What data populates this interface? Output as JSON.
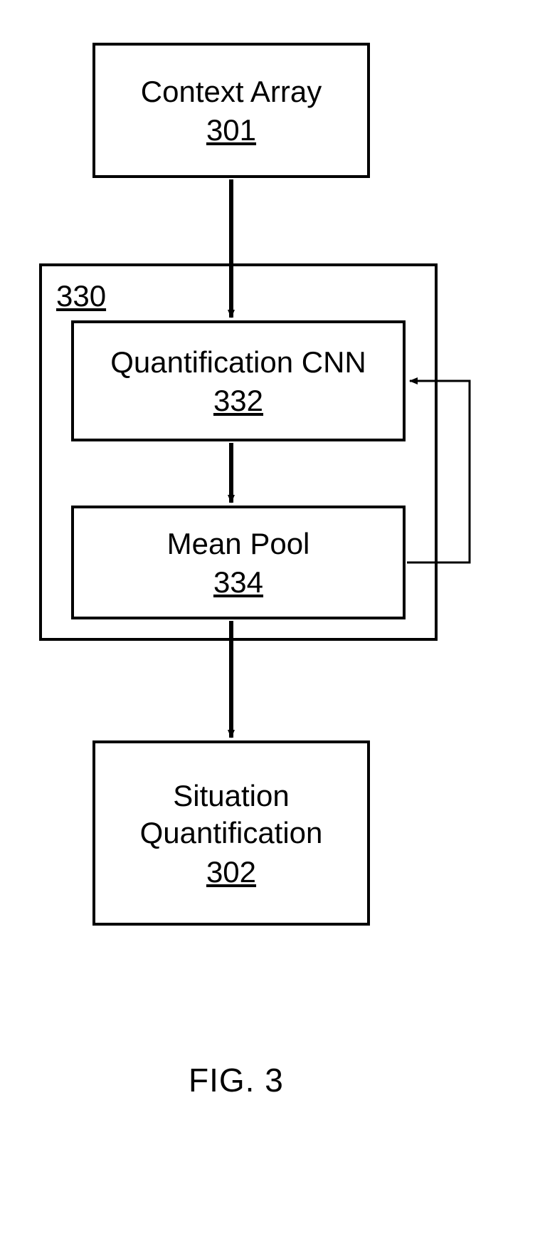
{
  "blocks": {
    "context_array": {
      "title": "Context Array",
      "num": "301"
    },
    "container": {
      "num": "330"
    },
    "quant_cnn": {
      "title": "Quantification CNN",
      "num": "332"
    },
    "mean_pool": {
      "title": "Mean Pool",
      "num": "334"
    },
    "situation": {
      "title_l1": "Situation",
      "title_l2": "Quantification",
      "num": "302"
    }
  },
  "figure_label": "FIG. 3"
}
